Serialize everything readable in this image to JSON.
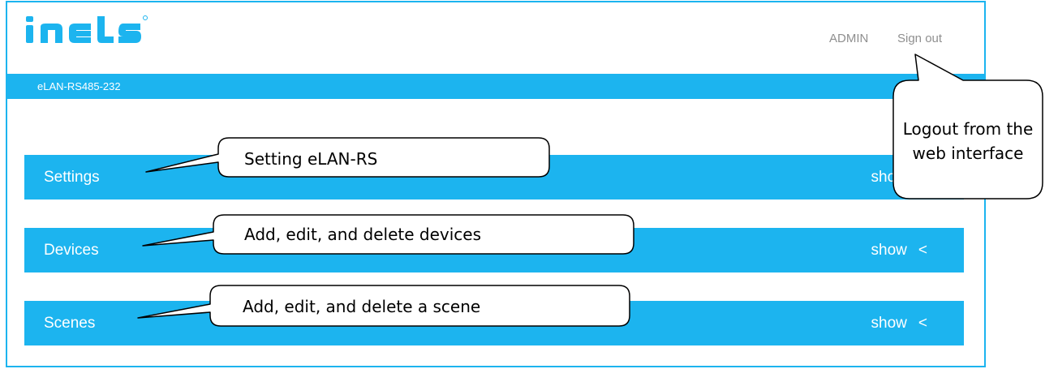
{
  "header": {
    "logo_text": "iNELS",
    "admin_label": "ADMIN",
    "signout_label": "Sign out"
  },
  "subbar": {
    "device_name": "eLAN-RS485-232"
  },
  "sections": [
    {
      "title": "Settings",
      "toggle_label": "show",
      "toggle_icon": "<"
    },
    {
      "title": "Devices",
      "toggle_label": "show",
      "toggle_icon": "<"
    },
    {
      "title": "Scenes",
      "toggle_label": "show",
      "toggle_icon": "<"
    }
  ],
  "callouts": {
    "settings": "Setting eLAN-RS",
    "devices": "Add, edit, and delete devices",
    "scenes": "Add, edit, and delete a scene",
    "logout": "Logout from the web interface"
  },
  "colors": {
    "accent": "#1cb4ef",
    "header_link": "#8f8f8f"
  }
}
